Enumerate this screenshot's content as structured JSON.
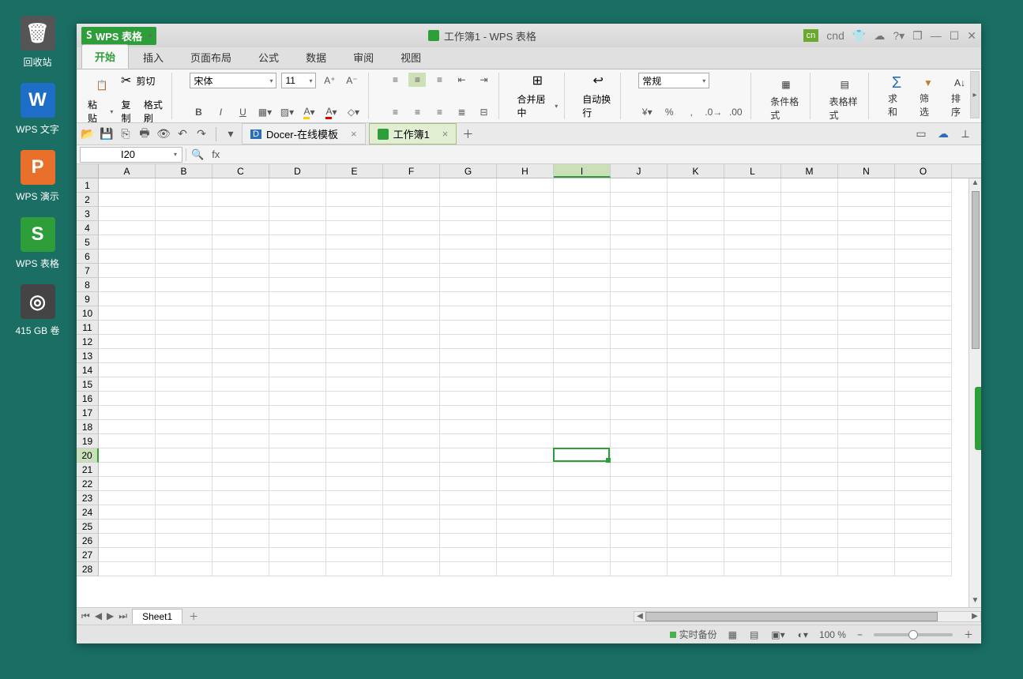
{
  "desktop": {
    "recycle": "回收站",
    "writer": "WPS 文字",
    "presentation": "WPS 演示",
    "spreadsheet": "WPS 表格",
    "disk": "415 GB 卷"
  },
  "titlebar": {
    "app_badge": "WPS 表格",
    "title": "工作簿1 - WPS 表格",
    "ime": "cn",
    "user": "cnd"
  },
  "menu": {
    "tabs": [
      "开始",
      "插入",
      "页面布局",
      "公式",
      "数据",
      "审阅",
      "视图"
    ],
    "active": 0
  },
  "ribbon": {
    "paste": "粘贴",
    "cut": "剪切",
    "copy": "复制",
    "format_painter": "格式刷",
    "font_name": "宋体",
    "font_size": "11",
    "merge_center": "合并居中",
    "wrap_text": "自动换行",
    "number_format": "常规",
    "cond_format": "条件格式",
    "table_style": "表格样式",
    "sum": "求和",
    "filter": "筛选",
    "sort": "排序"
  },
  "doc_tabs": {
    "docer": "Docer-在线模板",
    "workbook": "工作簿1"
  },
  "formula": {
    "cell_ref": "I20",
    "fx": "fx"
  },
  "grid": {
    "cols": [
      "A",
      "B",
      "C",
      "D",
      "E",
      "F",
      "G",
      "H",
      "I",
      "J",
      "K",
      "L",
      "M",
      "N",
      "O"
    ],
    "rows": 28,
    "sel_col": "I",
    "sel_row": 20
  },
  "sheets": {
    "sheet1": "Sheet1"
  },
  "status": {
    "backup": "实时备份",
    "zoom": "100 %"
  }
}
